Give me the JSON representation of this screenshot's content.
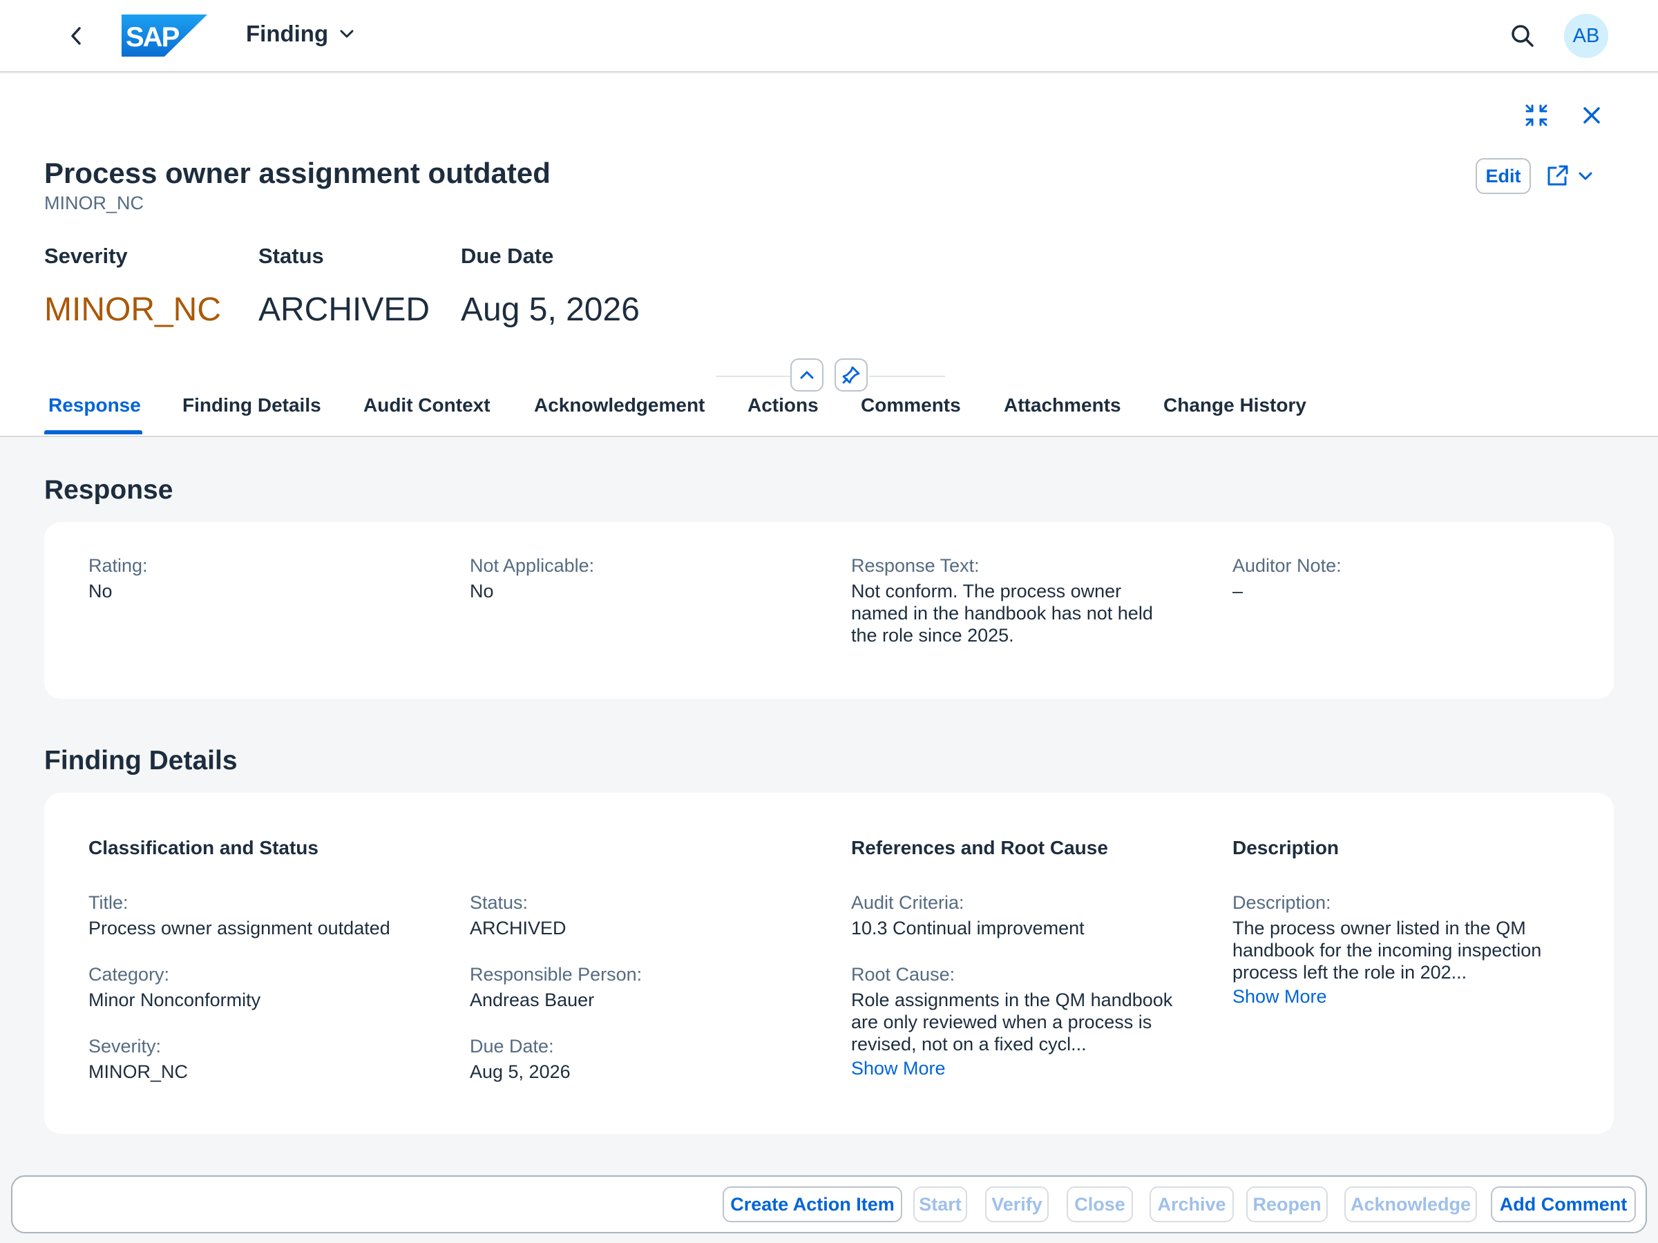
{
  "shell": {
    "app_title": "Finding",
    "avatar_initials": "AB",
    "logo_text": "SAP"
  },
  "header": {
    "title": "Process owner assignment outdated",
    "subtitle": "MINOR_NC",
    "edit_label": "Edit",
    "kpis": [
      {
        "label": "Severity",
        "value": "MINOR_NC"
      },
      {
        "label": "Status",
        "value": "ARCHIVED"
      },
      {
        "label": "Due Date",
        "value": "Aug 5, 2026"
      }
    ]
  },
  "tabs": [
    "Response",
    "Finding Details",
    "Audit Context",
    "Acknowledgement",
    "Actions",
    "Comments",
    "Attachments",
    "Change History"
  ],
  "response": {
    "title": "Response",
    "fields": [
      {
        "label": "Rating:",
        "value": "No"
      },
      {
        "label": "Not Applicable:",
        "value": "No"
      },
      {
        "label": "Response Text:",
        "value": "Not conform. The process owner named in the handbook has not held the role since 2025."
      },
      {
        "label": "Auditor Note:",
        "value": "–"
      }
    ]
  },
  "finding_details": {
    "title": "Finding Details",
    "groups": {
      "classification": "Classification and Status",
      "references": "References and Root Cause",
      "description": "Description"
    },
    "title_field": {
      "label": "Title:",
      "value": "Process owner assignment outdated"
    },
    "category": {
      "label": "Category:",
      "value": "Minor Nonconformity"
    },
    "severity": {
      "label": "Severity:",
      "value": "MINOR_NC"
    },
    "status": {
      "label": "Status:",
      "value": "ARCHIVED"
    },
    "responsible": {
      "label": "Responsible Person:",
      "value": "Andreas Bauer"
    },
    "due_date": {
      "label": "Due Date:",
      "value": "Aug 5, 2026"
    },
    "audit_criteria": {
      "label": "Audit Criteria:",
      "value": "10.3 Continual improvement"
    },
    "root_cause": {
      "label": "Root Cause:",
      "value": "Role assignments in the QM handbook are only reviewed when a process is revised, not on a fixed cycl..."
    },
    "description": {
      "label": "Description:",
      "value": "The process owner listed in the QM handbook for the incoming inspection process left the role in 202..."
    },
    "show_more": "Show More"
  },
  "footer": {
    "buttons": [
      {
        "label": "Create Action Item",
        "enabled": true
      },
      {
        "label": "Start",
        "enabled": false
      },
      {
        "label": "Verify",
        "enabled": false
      },
      {
        "label": "Close",
        "enabled": false
      },
      {
        "label": "Archive",
        "enabled": false
      },
      {
        "label": "Reopen",
        "enabled": false
      },
      {
        "label": "Acknowledge",
        "enabled": false
      },
      {
        "label": "Add Comment",
        "enabled": true
      }
    ]
  },
  "colors": {
    "accent": "#0064d9",
    "warning": "#aa5808",
    "text": "#1d2d3e",
    "label": "#556b82"
  }
}
